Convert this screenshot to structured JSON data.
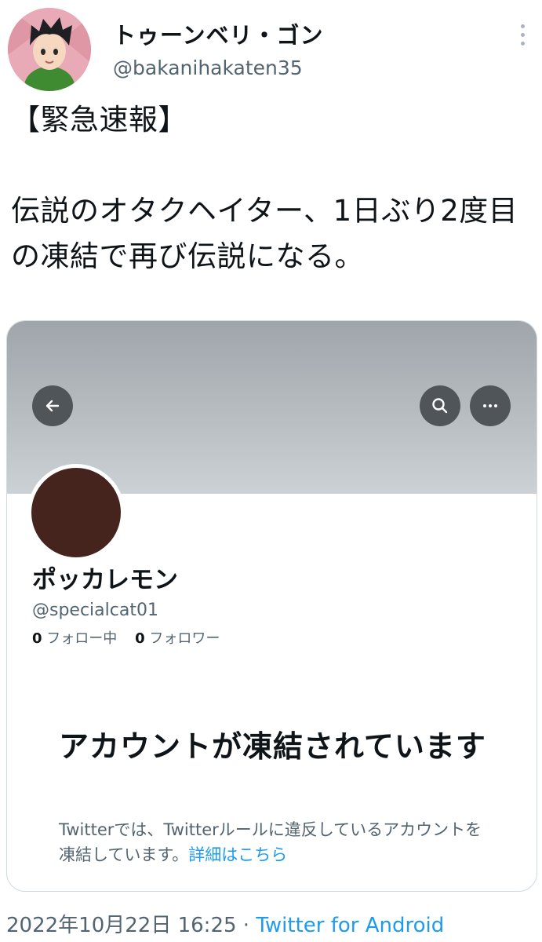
{
  "author": {
    "display_name": "トゥーンベリ・ゴン",
    "handle": "@bakanihakaten35"
  },
  "tweet": {
    "text": "【緊急速報】\n\n伝説のオタクヘイター、1日ぶり2度目の凍結で再び伝説になる。"
  },
  "card": {
    "display_name": "ポッカレモン",
    "handle": "@specialcat01",
    "following_count": "0",
    "following_label": "フォロー中",
    "followers_count": "0",
    "followers_label": "フォロワー",
    "suspended_title": "アカウントが凍結されています",
    "suspended_body": "Twitterでは、Twitterルールに違反しているアカウントを凍結しています。",
    "details_link": "詳細はこちら",
    "icons": [
      "back-arrow-icon",
      "search-icon",
      "more-icon"
    ]
  },
  "footer": {
    "timestamp": "2022年10月22日 16:25",
    "separator": " · ",
    "source": "Twitter for Android"
  },
  "colors": {
    "accent": "#1d9bf0",
    "secondary_text": "#536471",
    "profile_avatar": "#45241d"
  }
}
